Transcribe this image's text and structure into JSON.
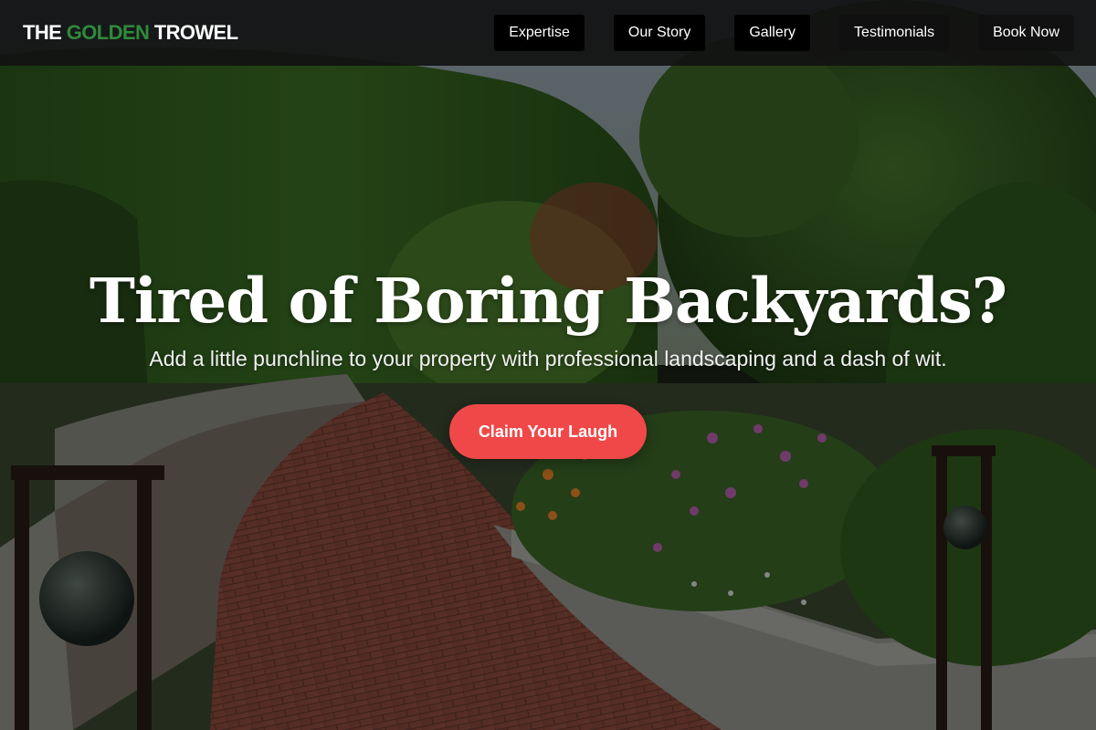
{
  "header": {
    "logo": {
      "part1": "THE ",
      "accent": "GOLDEN",
      "part2": " TROWEL"
    },
    "nav": [
      {
        "label": "Expertise"
      },
      {
        "label": "Our Story"
      },
      {
        "label": "Gallery"
      },
      {
        "label": "Testimonials"
      },
      {
        "label": "Book Now"
      }
    ]
  },
  "hero": {
    "title": "Tired of Boring Backyards?",
    "subtitle": "Add a little punchline to your property with professional landscaping and a dash of wit.",
    "cta_label": "Claim Your Laugh"
  },
  "colors": {
    "brand_accent": "#2f8a3a",
    "cta": "#f04848",
    "nav_background": "#121212",
    "nav_button": "#000000"
  },
  "icons": [
    "garden-path-photo"
  ]
}
